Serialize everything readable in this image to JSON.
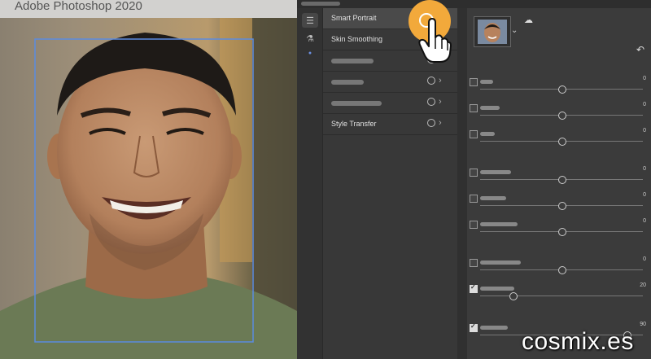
{
  "app": {
    "title": "Adobe Photoshop 2020"
  },
  "colors": {
    "accent": "#f2a93b",
    "face_box": "#5b8be0",
    "panel": "#383838"
  },
  "tools": [
    {
      "icon": "sliders-icon",
      "active": true
    },
    {
      "icon": "flask-icon",
      "active": false
    },
    {
      "icon": "dot-icon",
      "active": false
    }
  ],
  "filters": [
    {
      "label": "Smart Portrait",
      "selected": true
    },
    {
      "label": "Skin Smoothing"
    },
    {
      "label": ""
    },
    {
      "label": ""
    },
    {
      "label": ""
    },
    {
      "label": "Style Transfer"
    }
  ],
  "sliders": [
    {
      "checked": false,
      "value": "0",
      "level": 0.5
    },
    {
      "checked": false,
      "value": "0",
      "level": 0.5
    },
    {
      "checked": false,
      "value": "0",
      "level": 0.5
    },
    {
      "checked": false,
      "value": "0",
      "level": 0.5
    },
    {
      "checked": false,
      "value": "0",
      "level": 0.5
    },
    {
      "checked": false,
      "value": "0",
      "level": 0.5
    },
    {
      "checked": false,
      "value": "0",
      "level": 0.5
    },
    {
      "checked": true,
      "value": "20",
      "level": 0.2
    },
    {
      "checked": true,
      "value": "90",
      "level": 0.9
    }
  ],
  "watermark": "cosmix.es"
}
